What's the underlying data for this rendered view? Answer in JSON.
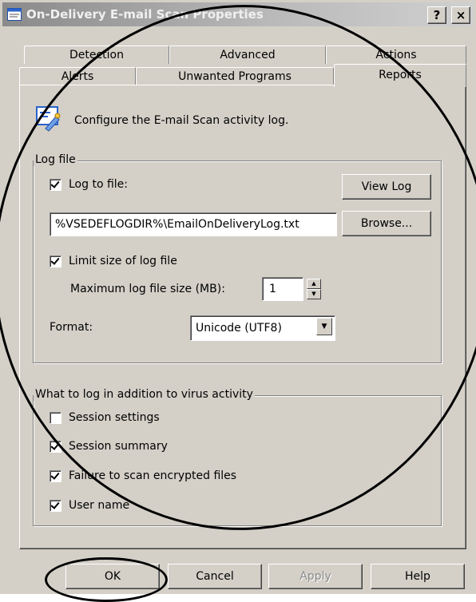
{
  "window": {
    "title": "On-Delivery E-mail Scan Properties",
    "help_glyph": "?",
    "close_glyph": "×"
  },
  "tabs_back": [
    "Detection",
    "Advanced",
    "Actions"
  ],
  "tabs_front": [
    "Alerts",
    "Unwanted Programs",
    "Reports"
  ],
  "selected_tab": "Reports",
  "header": {
    "icon": "log-config-icon",
    "text": "Configure the E-mail Scan activity log."
  },
  "log_file": {
    "group_label": "Log file",
    "log_to_file_label": "Log to file:",
    "log_to_file_checked": true,
    "view_log_button": "View Log",
    "path_value": "%VSEDEFLOGDIR%\\EmailOnDeliveryLog.txt",
    "browse_button": "Browse...",
    "limit_size_label": "Limit size of log file",
    "limit_size_checked": true,
    "max_size_label": "Maximum log file size (MB):",
    "max_size_value": "1",
    "format_label": "Format:",
    "format_value": "Unicode (UTF8)"
  },
  "what_to_log": {
    "group_label": "What to log in addition to virus activity",
    "options": [
      {
        "label": "Session settings",
        "checked": false
      },
      {
        "label": "Session summary",
        "checked": true
      },
      {
        "label": "Failure to scan encrypted files",
        "checked": true
      },
      {
        "label": "User name",
        "checked": true
      }
    ]
  },
  "buttons": {
    "ok": "OK",
    "cancel": "Cancel",
    "apply": "Apply",
    "help": "Help"
  },
  "colors": {
    "face": "#d4d0c8",
    "title_inactive": "#8a8a8a",
    "annotation": "#000000"
  }
}
